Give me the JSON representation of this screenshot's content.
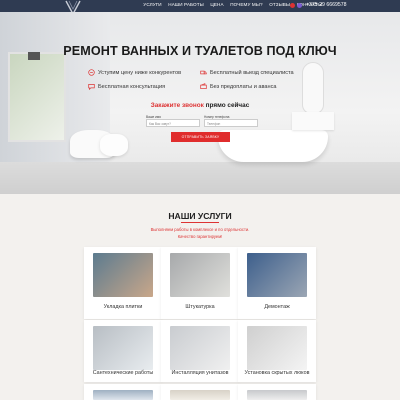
{
  "header": {
    "nav": [
      "УСЛУГИ",
      "НАШИ РАБОТЫ",
      "ЦЕНА",
      "ПОЧЕМУ МЫ?",
      "ОТЗЫВЫ",
      "КОНТАКТЫ"
    ],
    "phone": "+375 29 6669578",
    "colors": {
      "bar": "#2f3b52"
    }
  },
  "hero": {
    "title": "РЕМОНТ ВАННЫХ И ТУАЛЕТОВ ПОД КЛЮЧ",
    "features": [
      "Уступим цену ниже конкурентов",
      "Бесплатный выезд специалиста",
      "Бесплатная консультация",
      "Без предоплаты и аванса"
    ],
    "cta": {
      "red": "Закажите звонок",
      "rest": "прямо сейчас"
    },
    "form": {
      "name_label": "Ваше имя",
      "name_placeholder": "Как Вас зовут?",
      "phone_label": "Номер телефона",
      "phone_placeholder": "Телефон",
      "submit": "ОТПРАВИТЬ ЗАЯВКУ"
    }
  },
  "services": {
    "title": "НАШИ УСЛУГИ",
    "subtitle_1": "Выполняем работы в комплексе и по отдельности.",
    "subtitle_2": "Качество гарантируем!",
    "items": [
      "Укладка плитки",
      "Штукатурка",
      "Демонтаж",
      "Сантехнические работы",
      "Инсталляция унитазов",
      "Установка скрытых люков"
    ]
  },
  "colors": {
    "accent": "#e02d2d"
  }
}
